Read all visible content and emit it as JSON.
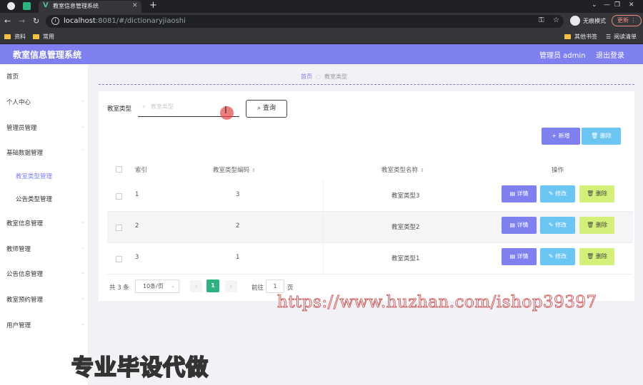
{
  "browser": {
    "tab_title": "教室信息管理系统",
    "url_host": "localhost",
    "url_rest": ":8081/#/dictionaryjiaoshi",
    "incognito_label": "无痕模式",
    "update_label": "更新",
    "bookmarks": [
      "资料",
      "常用"
    ],
    "bookmarks_right": [
      "其他书签",
      "阅读清单"
    ]
  },
  "header": {
    "title": "教室信息管理系统",
    "user": "管理员 admin",
    "logout": "退出登录"
  },
  "sidebar": {
    "items": [
      {
        "label": "首页"
      },
      {
        "label": "个人中心"
      },
      {
        "label": "管理员管理"
      },
      {
        "label": "基础数据管理"
      },
      {
        "label": "教室类型管理"
      },
      {
        "label": "公告类型管理"
      },
      {
        "label": "教室信息管理"
      },
      {
        "label": "教师管理"
      },
      {
        "label": "公告信息管理"
      },
      {
        "label": "教室预约管理"
      },
      {
        "label": "用户管理"
      }
    ]
  },
  "breadcrumb": {
    "home": "首页",
    "current": "教室类型"
  },
  "search": {
    "label": "教室类型",
    "placeholder": "教室类型",
    "button": "查询"
  },
  "toolbar": {
    "add": "新增",
    "delete": "删除"
  },
  "table": {
    "headers": {
      "index": "索引",
      "code": "教室类型编码",
      "name": "教室类型名称",
      "actions": "操作"
    },
    "rows": [
      {
        "index": "1",
        "code": "3",
        "name": "教室类型3"
      },
      {
        "index": "2",
        "code": "2",
        "name": "教室类型2"
      },
      {
        "index": "3",
        "code": "1",
        "name": "教室类型1"
      }
    ],
    "action_labels": {
      "detail": "详情",
      "edit": "修改",
      "delete": "删除"
    }
  },
  "pagination": {
    "total": "共 3 条",
    "page_size": "10条/页",
    "current": "1",
    "goto_label": "前往",
    "goto_value": "1",
    "page_suffix": "页"
  },
  "overlays": {
    "watermark": "https://www.huzhan.com/ishop39397",
    "promo": "专业毕设代做"
  },
  "colors": {
    "accent": "#7f80ef",
    "info": "#6ac5f3",
    "warning": "#d4f07a",
    "pager_active": "#2db37f"
  }
}
